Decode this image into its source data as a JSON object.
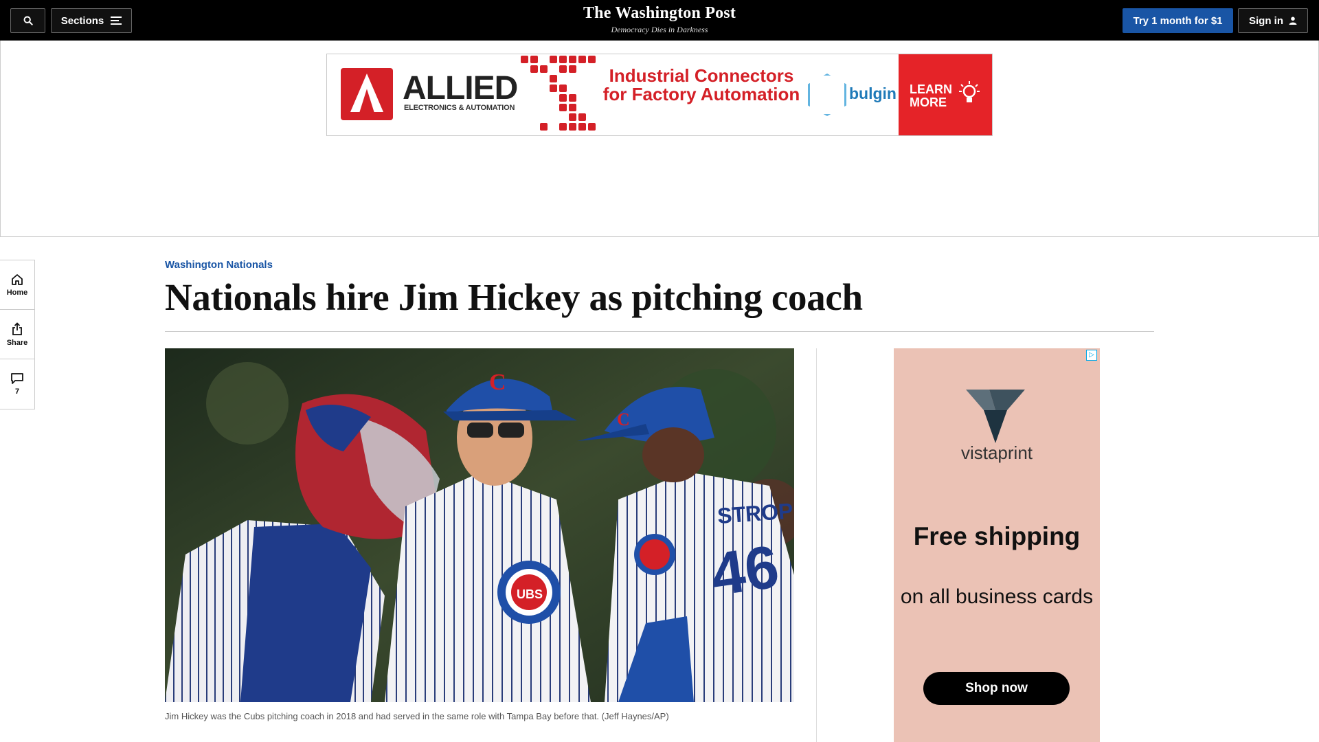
{
  "header": {
    "sections_label": "Sections",
    "logo": "The Washington Post",
    "tagline": "Democracy Dies in Darkness",
    "subscribe_label": "Try 1 month for $1",
    "signin_label": "Sign in"
  },
  "top_ad": {
    "brand": "ALLIED",
    "brand_sub": "ELECTRONICS & AUTOMATION",
    "headline": "Industrial Connectors for Factory Automation",
    "partner": "bulgin",
    "cta": "LEARN MORE",
    "accent": "#d42027"
  },
  "rail": {
    "home_label": "Home",
    "share_label": "Share",
    "comments_count": "7"
  },
  "article": {
    "kicker": "Washington Nationals",
    "headline": "Nationals hire Jim Hickey as pitching coach",
    "caption": "Jim Hickey was the Cubs pitching coach in 2018 and had served in the same role with Tampa Bay before that. (Jeff Haynes/AP)"
  },
  "side_ad": {
    "brand": "vistaprint",
    "headline": "Free shipping",
    "body": "on all business cards",
    "cta": "Shop now",
    "background": "#ebc2b5"
  },
  "colors": {
    "header_bg": "#000000",
    "link_blue": "#1955a5"
  }
}
